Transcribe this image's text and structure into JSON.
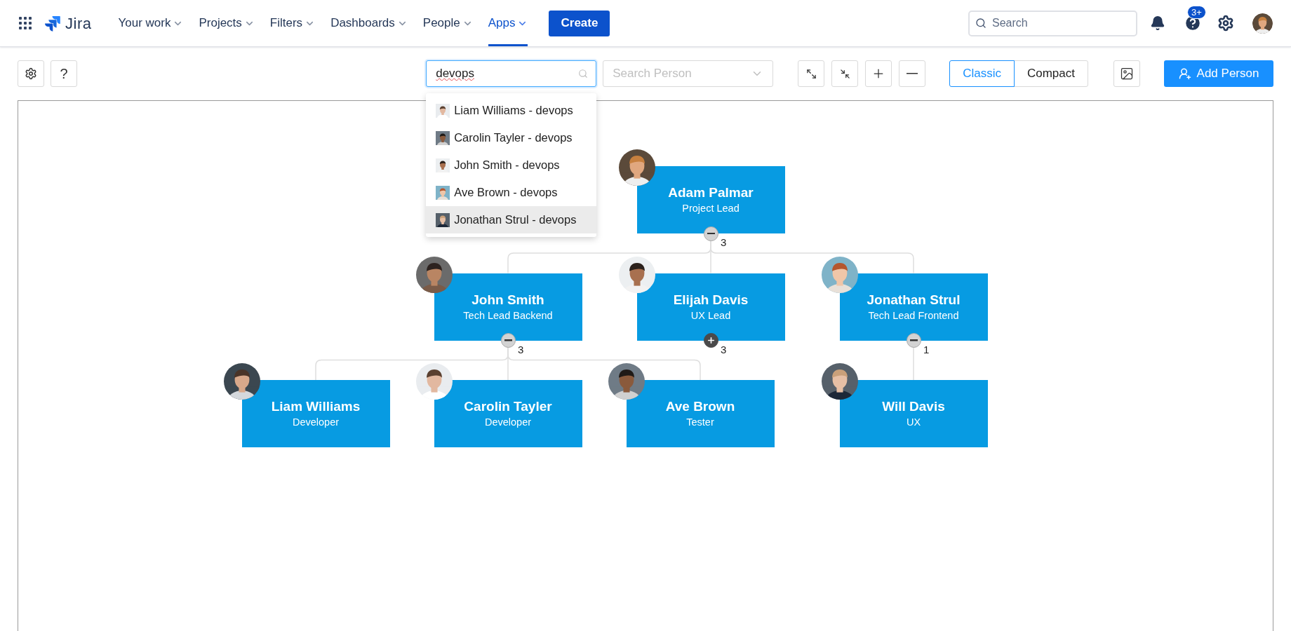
{
  "nav": {
    "app_name": "Jira",
    "items": [
      {
        "label": "Your work",
        "selected": false
      },
      {
        "label": "Projects",
        "selected": false
      },
      {
        "label": "Filters",
        "selected": false
      },
      {
        "label": "Dashboards",
        "selected": false
      },
      {
        "label": "People",
        "selected": false
      },
      {
        "label": "Apps",
        "selected": true
      }
    ],
    "create_button": "Create",
    "search": {
      "placeholder": "Search"
    },
    "notification_badge": "3+"
  },
  "toolbar": {
    "help_button": "?",
    "search": {
      "value": "devops"
    },
    "person_select": {
      "placeholder": "Search Person"
    },
    "view_modes": [
      {
        "label": "Classic",
        "selected": true
      },
      {
        "label": "Compact",
        "selected": false
      }
    ],
    "add_button": "Add Person"
  },
  "search_results": [
    {
      "label": "Liam Williams - devops",
      "selected": false
    },
    {
      "label": "Carolin Tayler - devops",
      "selected": false
    },
    {
      "label": "John Smith - devops",
      "selected": false
    },
    {
      "label": "Ave Brown - devops",
      "selected": false
    },
    {
      "label": "Jonathan Strul - devops",
      "selected": true
    }
  ],
  "org_chart": {
    "root": {
      "name": "Adam Palmar",
      "role": "Project Lead",
      "expanded": true,
      "count": "3",
      "children": [
        {
          "name": "John Smith",
          "role": "Tech Lead Backend",
          "expanded": true,
          "count": "3",
          "children": [
            {
              "name": "Liam Williams",
              "role": "Developer"
            },
            {
              "name": "Carolin Tayler",
              "role": "Developer"
            },
            {
              "name": "Ave Brown",
              "role": "Tester"
            }
          ]
        },
        {
          "name": "Elijah Davis",
          "role": "UX Lead",
          "expanded": false,
          "count": "3"
        },
        {
          "name": "Jonathan Strul",
          "role": "Tech Lead Frontend",
          "expanded": true,
          "count": "1",
          "children": [
            {
              "name": "Will Davis",
              "role": "UX"
            }
          ]
        }
      ]
    }
  }
}
